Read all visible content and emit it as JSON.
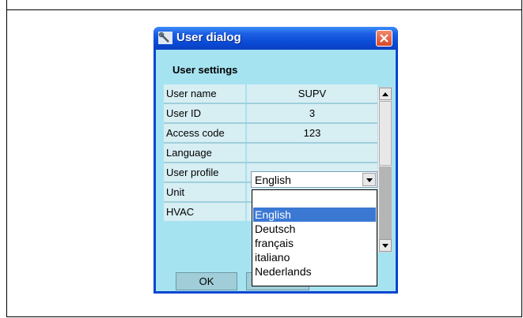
{
  "dialog": {
    "title": "User dialog",
    "section_title": "User settings",
    "ok_label": "OK"
  },
  "fields": [
    {
      "label": "User name",
      "value": "SUPV"
    },
    {
      "label": "User ID",
      "value": "3"
    },
    {
      "label": "Access code",
      "value": "123"
    },
    {
      "label": "Language",
      "value": "English"
    },
    {
      "label": "User profile",
      "value": ""
    },
    {
      "label": "Unit",
      "value": ""
    },
    {
      "label": "HVAC",
      "value": ""
    }
  ],
  "language_dropdown": {
    "selected": "English",
    "options": [
      "English",
      "Deutsch",
      "français",
      "italiano",
      "Nederlands"
    ]
  },
  "icons": {
    "title": "wrench-icon",
    "close": "close-icon",
    "dropdown": "chevron-down-icon"
  },
  "colors": {
    "titlebar": "#0a4ad6",
    "client": "#a6e3f1",
    "selection": "#3a78d4",
    "close": "#d8462a"
  }
}
